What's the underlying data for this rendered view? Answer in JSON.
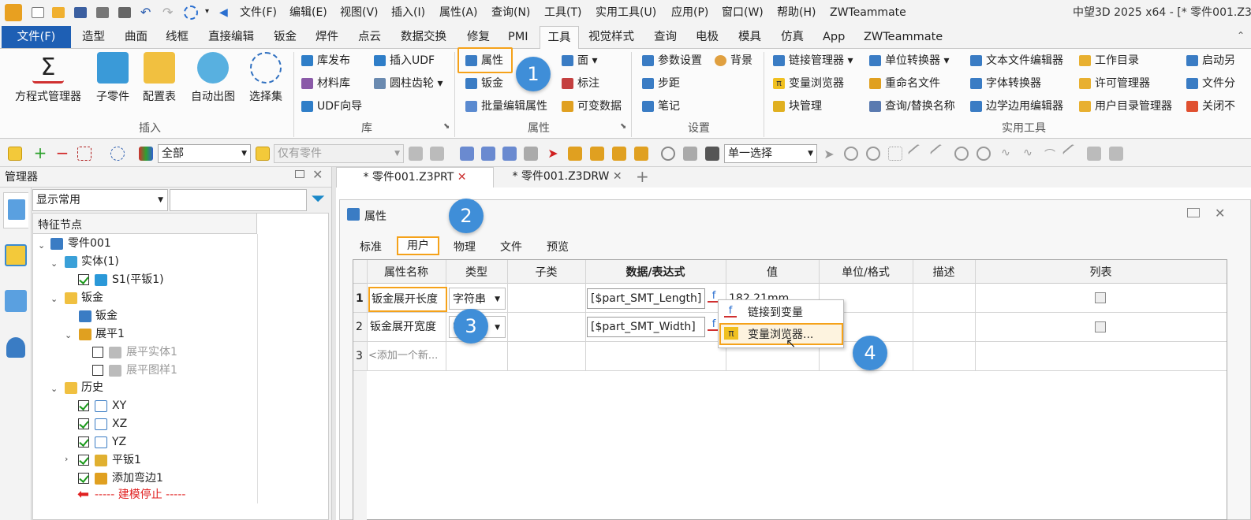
{
  "menubar": {
    "items": [
      "文件(F)",
      "编辑(E)",
      "视图(V)",
      "插入(I)",
      "属性(A)",
      "查询(N)",
      "工具(T)",
      "实用工具(U)",
      "应用(P)",
      "窗口(W)",
      "帮助(H)",
      "ZWTeammate"
    ],
    "title": "中望3D 2025 x64 - [* 零件001.Z3"
  },
  "ribbon_tabs": [
    "文件(F)",
    "造型",
    "曲面",
    "线框",
    "直接编辑",
    "钣金",
    "焊件",
    "点云",
    "数据交换",
    "修复",
    "PMI",
    "工具",
    "视觉样式",
    "查询",
    "电极",
    "模具",
    "仿真",
    "App",
    "ZWTeammate"
  ],
  "ribbon": {
    "insert": {
      "items": [
        "方程式管理器",
        "子零件",
        "配置表",
        "自动出图",
        "选择集"
      ],
      "group": "插入"
    },
    "library": {
      "items": [
        "库发布",
        "材料库",
        "UDF向导",
        "插入UDF",
        "圆柱齿轮"
      ],
      "group": "库"
    },
    "attributes": {
      "items": [
        "属性",
        "钣金",
        "批量编辑属性",
        "面",
        "标注",
        "可变数据"
      ],
      "group": "属性"
    },
    "settings": {
      "items": [
        "参数设置",
        "背景",
        "步距",
        "笔记"
      ],
      "group": "设置"
    },
    "utilities": {
      "items": [
        "链接管理器",
        "变量浏览器",
        "块管理",
        "单位转换器",
        "重命名文件",
        "查询/替换名称",
        "文本文件编辑器",
        "字体转换器",
        "边学边用编辑器",
        "工作目录",
        "许可管理器",
        "用户目录管理器",
        "启动另",
        "文件分",
        "关闭不"
      ],
      "group": "实用工具"
    }
  },
  "toolbar": {
    "filter": "全部",
    "part_filter": "仅有零件",
    "select_mode": "单一选择"
  },
  "manager": {
    "title": "管理器",
    "display": "显示常用",
    "column": "特征节点"
  },
  "tree": [
    {
      "label": "零件001"
    },
    {
      "label": "实体(1)"
    },
    {
      "label": "S1(平钣1)"
    },
    {
      "label": "钣金"
    },
    {
      "label": "钣金"
    },
    {
      "label": "展平1"
    },
    {
      "label": "展平实体1"
    },
    {
      "label": "展平图样1"
    },
    {
      "label": "历史"
    },
    {
      "label": "XY"
    },
    {
      "label": "XZ"
    },
    {
      "label": "YZ"
    },
    {
      "label": "平钣1"
    },
    {
      "label": "添加弯边1"
    },
    {
      "label": "----- 建模停止 -----"
    }
  ],
  "doc_tabs": [
    "* 零件001.Z3PRT",
    "* 零件001.Z3DRW",
    "+"
  ],
  "dialog": {
    "title": "属性",
    "tabs": [
      "标准",
      "用户",
      "物理",
      "文件",
      "预览"
    ],
    "columns": [
      "属性名称",
      "类型",
      "子类",
      "数据/表达式",
      "值",
      "单位/格式",
      "描述",
      "列表"
    ],
    "rows": [
      {
        "num": "1",
        "name": "钣金展开长度",
        "type": "字符串",
        "expr": "[$part_SMT_Length]",
        "value": "182.21mm"
      },
      {
        "num": "2",
        "name": "钣金展开宽度",
        "type": "字符串",
        "expr": "[$part_SMT_Width]",
        "value": ""
      },
      {
        "num": "3",
        "name": "<添加一个新...",
        "type": "",
        "expr": "",
        "value": ""
      }
    ],
    "context_menu": [
      "链接到变量",
      "变量浏览器..."
    ]
  },
  "badges": [
    "1",
    "2",
    "3",
    "4"
  ],
  "accent": "#1e5fb4"
}
